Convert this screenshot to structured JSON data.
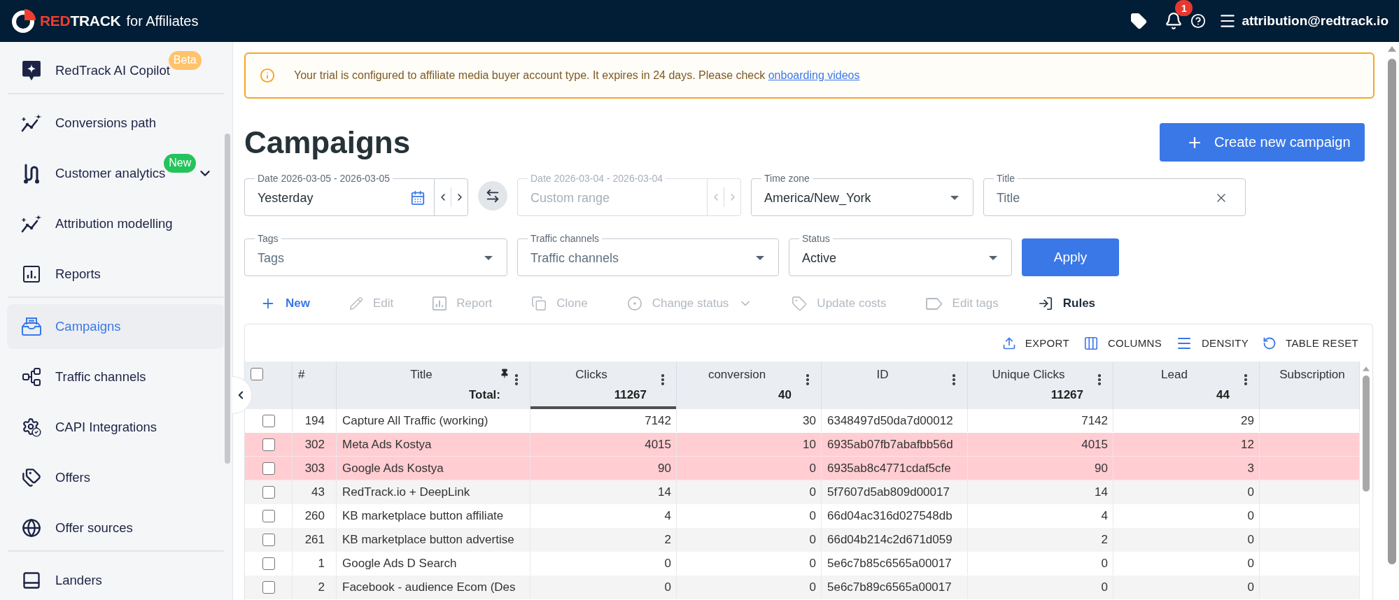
{
  "topbar": {
    "logo": {
      "accent": "RED",
      "name": "TRACK",
      "suffix": "for Affiliates"
    },
    "notifications": "1",
    "user": "attribution@redtrack.io"
  },
  "sidebar": {
    "sections": [
      {
        "items": [
          {
            "label": "RedTrack AI Copilot",
            "selected": false,
            "badge": {
              "text": "Beta",
              "color": "#ffc36b"
            }
          }
        ]
      },
      {
        "items": [
          {
            "label": "Conversions path",
            "selected": false
          },
          {
            "label": "Customer analytics",
            "selected": false,
            "badge": {
              "text": "New",
              "color": "#24c35c"
            },
            "expanded": false
          },
          {
            "label": "Attribution modelling",
            "selected": false
          },
          {
            "label": "Reports",
            "selected": false
          }
        ]
      },
      {
        "items": [
          {
            "label": "Campaigns",
            "selected": true
          },
          {
            "label": "Traffic channels",
            "selected": false
          },
          {
            "label": "CAPI Integrations",
            "selected": false
          },
          {
            "label": "Offers",
            "selected": false
          },
          {
            "label": "Offer sources",
            "selected": false
          }
        ]
      },
      {
        "items": [
          {
            "label": "Landers",
            "selected": false
          }
        ]
      }
    ]
  },
  "banner": {
    "text": "Your trial is configured to affiliate media buyer account type. It expires in 24 days. Please check",
    "link": "onboarding videos"
  },
  "page_title": "Campaigns",
  "create_button": "Create new campaign",
  "filters": [
    [
      {
        "kind": "date",
        "label": "Date 2026-03-05 - 2026-03-05",
        "value": "Yesterday",
        "disabled": false
      },
      {
        "kind": "swap"
      },
      {
        "kind": "date",
        "label": "Date 2026-03-04 - 2026-03-04",
        "placeholder": "Custom range",
        "disabled": true
      },
      {
        "kind": "select",
        "label": "Time zone",
        "value": "America/New_York",
        "disabled": false
      },
      {
        "kind": "text",
        "label": "Title",
        "placeholder": "Title",
        "disabled": false
      }
    ],
    [
      {
        "kind": "select",
        "label": "Tags",
        "placeholder": "Tags",
        "disabled": false
      },
      {
        "kind": "select",
        "label": "Traffic channels",
        "placeholder": "Traffic channels",
        "disabled": false
      },
      {
        "kind": "select",
        "label": "Status",
        "value": "Active",
        "disabled": false
      },
      {
        "kind": "button",
        "label": "Apply"
      }
    ]
  ],
  "actions": [
    {
      "label": "New",
      "disabled": false,
      "primary": true,
      "dropdown": false
    },
    {
      "label": "Edit",
      "disabled": true,
      "primary": false,
      "dropdown": false
    },
    {
      "label": "Report",
      "disabled": true,
      "primary": false,
      "dropdown": false
    },
    {
      "label": "Clone",
      "disabled": true,
      "primary": false,
      "dropdown": false
    },
    {
      "label": "Change status",
      "disabled": true,
      "primary": false,
      "dropdown": true
    },
    {
      "label": "Update costs",
      "disabled": true,
      "primary": false,
      "dropdown": false
    },
    {
      "label": "Edit tags",
      "disabled": true,
      "primary": false,
      "dropdown": false
    },
    {
      "label": "Rules",
      "disabled": false,
      "primary": false,
      "dropdown": false
    }
  ],
  "table": {
    "tools": [
      "EXPORT",
      "COLUMNS",
      "DENSITY",
      "TABLE RESET"
    ],
    "select_all": {
      "checked": false
    },
    "columns": [
      {
        "label": "#",
        "kind": "index",
        "pinned": false,
        "sorted": false,
        "menu": false
      },
      {
        "label": "Title",
        "kind": "text",
        "total": "Total:",
        "pinned": true,
        "sorted": false,
        "menu": true
      },
      {
        "label": "Clicks",
        "kind": "number",
        "total": "11267",
        "pinned": false,
        "sorted": true,
        "menu": true
      },
      {
        "label": "conversion",
        "kind": "number",
        "total": "40",
        "pinned": false,
        "sorted": false,
        "menu": true
      },
      {
        "label": "ID",
        "kind": "text",
        "pinned": false,
        "sorted": false,
        "menu": true
      },
      {
        "label": "Unique Clicks",
        "kind": "number",
        "total": "11267",
        "pinned": false,
        "sorted": false,
        "menu": true
      },
      {
        "label": "Lead",
        "kind": "number",
        "total": "44",
        "pinned": false,
        "sorted": false,
        "menu": true
      },
      {
        "label": "Subscription",
        "kind": "number",
        "pinned": false,
        "sorted": false,
        "menu": false
      }
    ],
    "rows": [
      {
        "checked": false,
        "highlighted": false,
        "cells": [
          "194",
          "Capture All Traffic (working)",
          "7142",
          "30",
          "6348497d50da7d00012",
          "7142",
          "29"
        ]
      },
      {
        "checked": false,
        "highlighted": true,
        "cells": [
          "302",
          "Meta Ads Kostya",
          "4015",
          "10",
          "6935ab07fb7abafbb56d",
          "4015",
          "12"
        ]
      },
      {
        "checked": false,
        "highlighted": true,
        "cells": [
          "303",
          "Google Ads Kostya",
          "90",
          "0",
          "6935ab8c4771cdaf5cfe",
          "90",
          "3"
        ]
      },
      {
        "checked": false,
        "highlighted": false,
        "cells": [
          "43",
          "RedTrack.io + DeepLink",
          "14",
          "0",
          "5f7607d5ab809d00017",
          "14",
          "0"
        ]
      },
      {
        "checked": false,
        "highlighted": false,
        "cells": [
          "260",
          "KB marketplace button affiliate",
          "4",
          "0",
          "66d04ac316d027548db",
          "4",
          "0"
        ]
      },
      {
        "checked": false,
        "highlighted": false,
        "cells": [
          "261",
          "KB marketplace button advertise",
          "2",
          "0",
          "66d04b214c2d671d059",
          "2",
          "0"
        ]
      },
      {
        "checked": false,
        "highlighted": false,
        "cells": [
          "1",
          "Google Ads D Search",
          "0",
          "0",
          "5e6c7b85c6565a00017",
          "0",
          "0"
        ]
      },
      {
        "checked": false,
        "highlighted": false,
        "cells": [
          "2",
          "Facebook - audience Ecom (Des",
          "0",
          "0",
          "5e6c7b89c6565a00017",
          "0",
          "0"
        ]
      }
    ]
  }
}
